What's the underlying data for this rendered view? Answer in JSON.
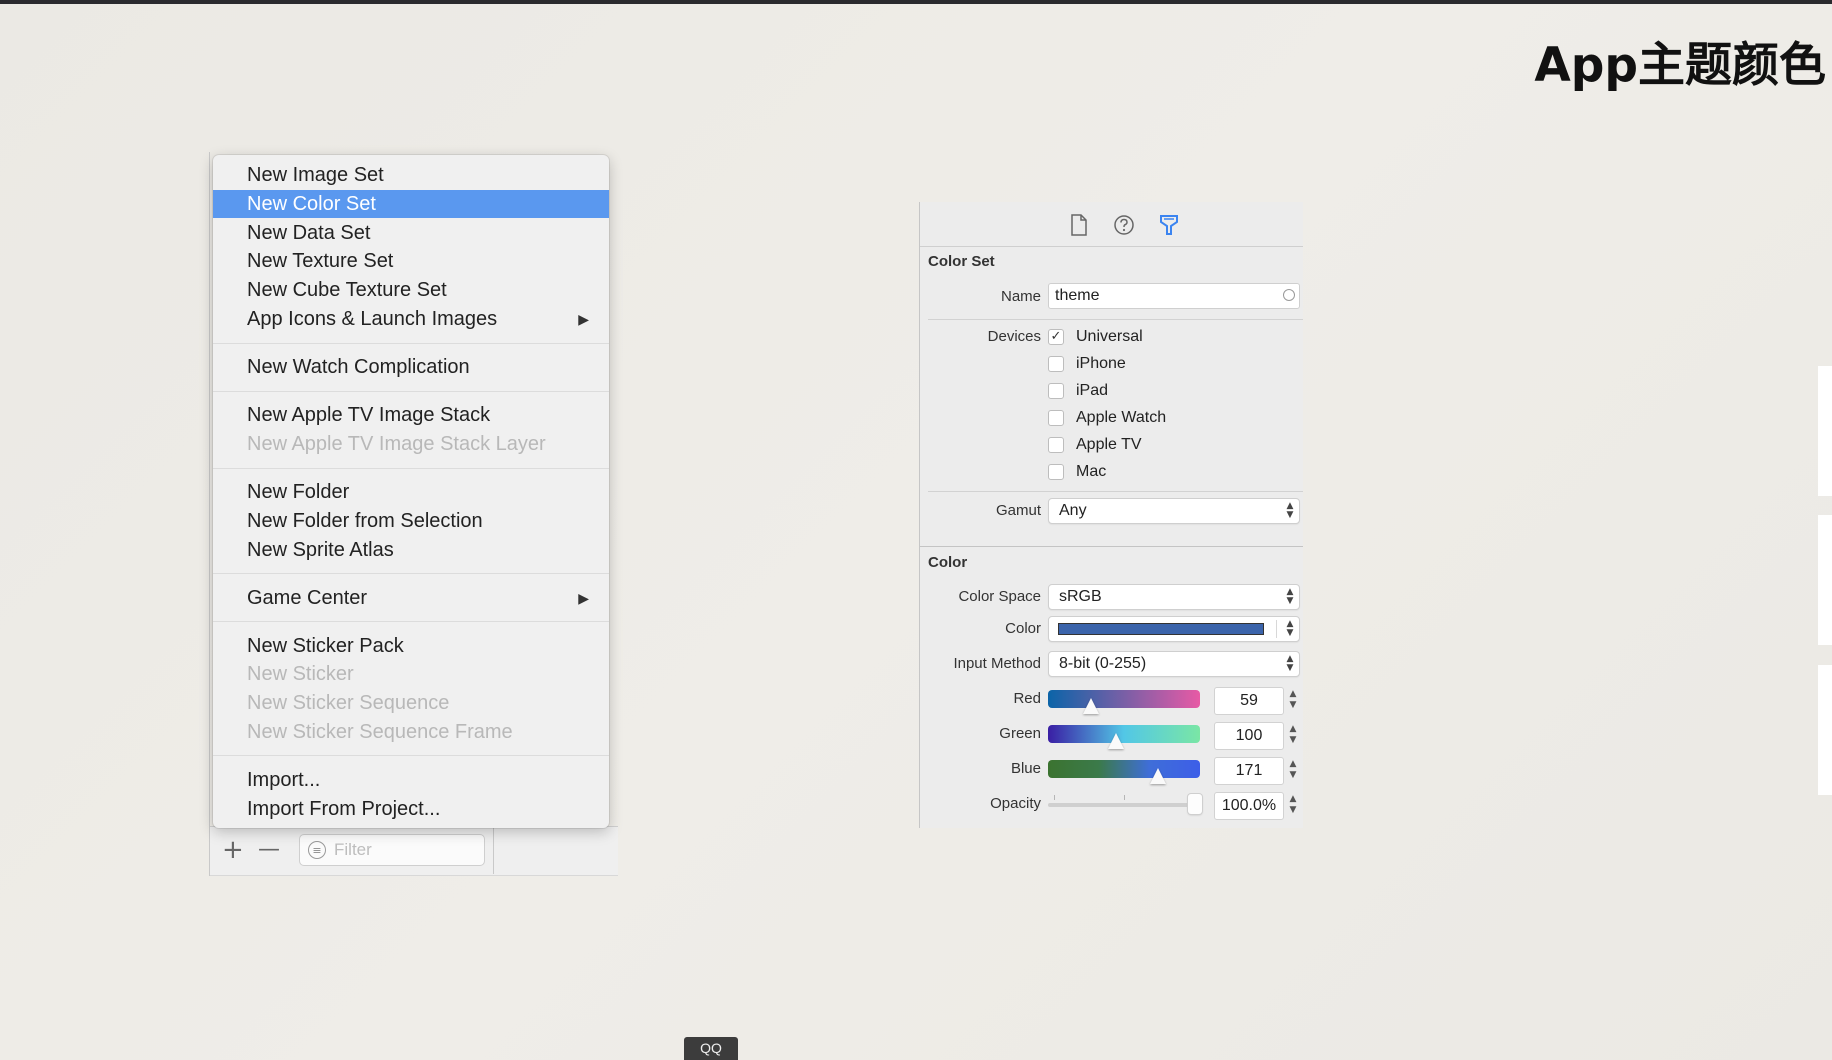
{
  "slide": {
    "title": "App主题颜色"
  },
  "menu": {
    "items": [
      {
        "label": "New Image Set",
        "state": "normal"
      },
      {
        "label": "New Color Set",
        "state": "selected"
      },
      {
        "label": "New Data Set",
        "state": "normal"
      },
      {
        "label": "New Texture Set",
        "state": "normal"
      },
      {
        "label": "New Cube Texture Set",
        "state": "normal"
      },
      {
        "label": "App Icons & Launch Images",
        "state": "normal",
        "submenu": true
      },
      {
        "label": "New Watch Complication",
        "state": "normal"
      },
      {
        "label": "New Apple TV Image Stack",
        "state": "normal"
      },
      {
        "label": "New Apple TV Image Stack Layer",
        "state": "disabled"
      },
      {
        "label": "New Folder",
        "state": "normal"
      },
      {
        "label": "New Folder from Selection",
        "state": "normal"
      },
      {
        "label": "New Sprite Atlas",
        "state": "normal"
      },
      {
        "label": "Game Center",
        "state": "normal",
        "submenu": true
      },
      {
        "label": "New Sticker Pack",
        "state": "normal"
      },
      {
        "label": "New Sticker",
        "state": "disabled"
      },
      {
        "label": "New Sticker Sequence",
        "state": "disabled"
      },
      {
        "label": "New Sticker Sequence Frame",
        "state": "disabled"
      },
      {
        "label": "Import...",
        "state": "normal"
      },
      {
        "label": "Import From Project...",
        "state": "normal"
      }
    ],
    "submenu_arrow": "▶",
    "selected_color": "#5a98ef"
  },
  "navigator": {
    "add_label": "+",
    "remove_label": "—",
    "filter_placeholder": "Filter",
    "filter_icon": "filter-icon"
  },
  "inspector": {
    "tabs": [
      {
        "icon": "file-icon"
      },
      {
        "icon": "help-icon"
      },
      {
        "icon": "attributes-icon",
        "active": true
      }
    ],
    "color_set": {
      "header": "Color Set",
      "name_label": "Name",
      "name_value": "theme",
      "devices_label": "Devices",
      "devices": [
        {
          "label": "Universal",
          "checked": true,
          "check_glyph": "✓"
        },
        {
          "label": "iPhone",
          "checked": false
        },
        {
          "label": "iPad",
          "checked": false
        },
        {
          "label": "Apple Watch",
          "checked": false
        },
        {
          "label": "Apple TV",
          "checked": false
        },
        {
          "label": "Mac",
          "checked": false
        }
      ],
      "gamut_label": "Gamut",
      "gamut_value": "Any"
    },
    "color": {
      "header": "Color",
      "color_space_label": "Color Space",
      "color_space_value": "sRGB",
      "color_label": "Color",
      "swatch": "#3b64ab",
      "input_method_label": "Input Method",
      "input_method_value": "8-bit (0-255)",
      "red_label": "Red",
      "red_value": "59",
      "green_label": "Green",
      "green_value": "100",
      "blue_label": "Blue",
      "blue_value": "171",
      "opacity_label": "Opacity",
      "opacity_value": "100.0%",
      "opacity_fraction": 1.0
    }
  },
  "taskbar": {
    "qq_label": "QQ"
  }
}
